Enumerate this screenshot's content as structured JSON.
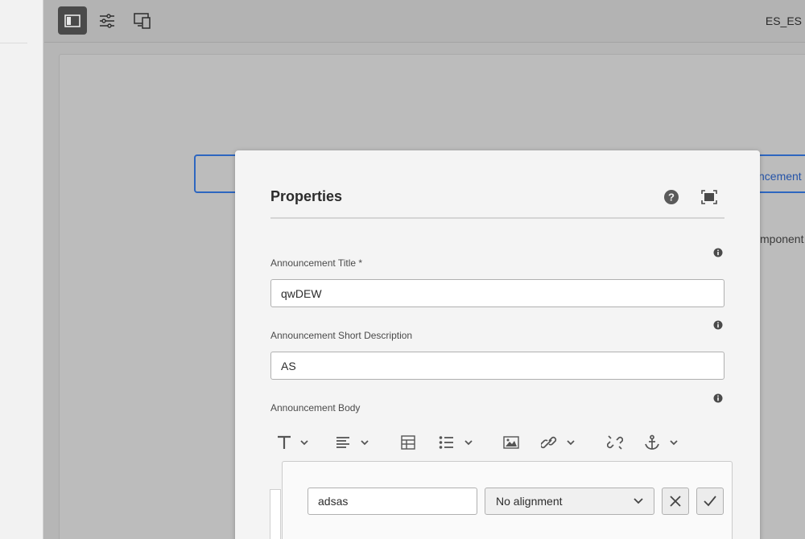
{
  "toolbar": {
    "buttons": [
      {
        "icon": "side-panel-icon",
        "active": true
      },
      {
        "icon": "properties-sliders-icon",
        "active": false
      },
      {
        "icon": "emulator-devices-icon",
        "active": false
      }
    ],
    "locale": "ES_ES"
  },
  "canvas": {
    "peek_title": "ncement",
    "peek_caption": "mponent"
  },
  "dialog": {
    "title": "Properties",
    "help_icon": "help-icon",
    "fullscreen_icon": "fullscreen-icon",
    "fields": {
      "title": {
        "label": "Announcement Title *",
        "value": "qwDEW"
      },
      "short_description": {
        "label": "Announcement Short Description",
        "value": "AS"
      },
      "body": {
        "label": "Announcement Body"
      }
    },
    "rte_toolbar": [
      "paragraph-format-icon",
      "justify-icon",
      "table-icon",
      "list-icon",
      "image-icon",
      "link-icon",
      "unlink-icon",
      "anchor-icon"
    ],
    "link_popover": {
      "input_value": "adsas",
      "alignment_value": "No alignment"
    }
  },
  "colors": {
    "accent": "#2d66c0",
    "overlay": "#b6b6b6",
    "dialog_bg": "#f4f4f4"
  }
}
